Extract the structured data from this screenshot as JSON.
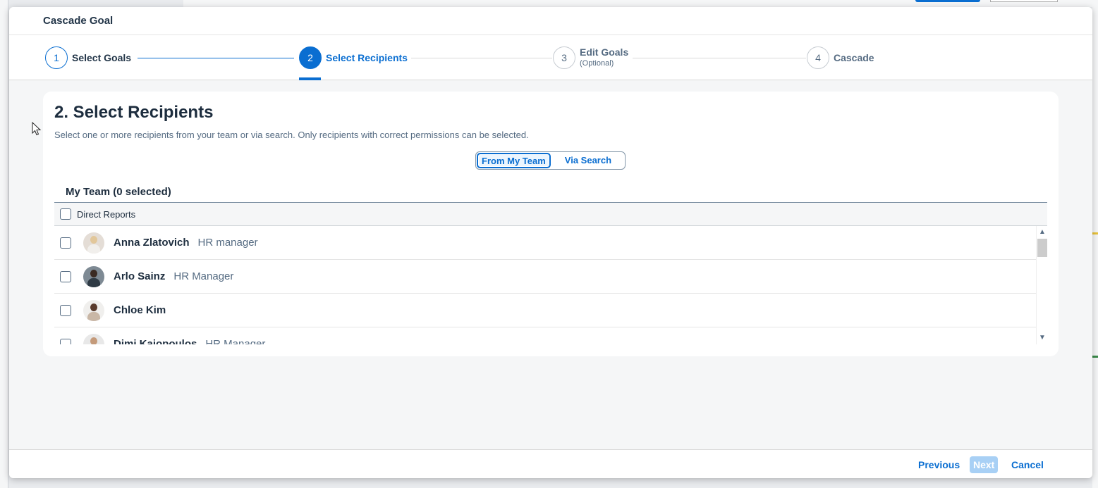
{
  "dialog": {
    "title": "Cascade Goal"
  },
  "wizard": {
    "steps": [
      {
        "number": "1",
        "label": "Select Goals",
        "sublabel": "",
        "state": "done"
      },
      {
        "number": "2",
        "label": "Select Recipients",
        "sublabel": "",
        "state": "active"
      },
      {
        "number": "3",
        "label": "Edit Goals",
        "sublabel": "(Optional)",
        "state": "pending"
      },
      {
        "number": "4",
        "label": "Cascade",
        "sublabel": "",
        "state": "pending"
      }
    ]
  },
  "content": {
    "heading": "2. Select Recipients",
    "description": "Select one or more recipients from your team or via search. Only recipients with correct permissions can be selected.",
    "segments": {
      "from_my_team": "From My Team",
      "via_search": "Via Search",
      "selected": "from_my_team"
    },
    "team_title": "My Team (0 selected)",
    "table_header": "Direct Reports",
    "rows": [
      {
        "name": "Anna Zlatovich",
        "role": "HR manager"
      },
      {
        "name": "Arlo Sainz",
        "role": "HR Manager"
      },
      {
        "name": "Chloe Kim",
        "role": ""
      },
      {
        "name": "Dimi Kaiopoulos",
        "role": "HR Manager"
      }
    ]
  },
  "footer": {
    "previous_label": "Previous",
    "next_label": "Next",
    "cancel_label": "Cancel"
  },
  "icons": {
    "scroll_up": "chevron-up-icon",
    "scroll_down": "chevron-down-icon",
    "cursor": "mouse-pointer-icon"
  },
  "colors": {
    "accent": "#0a6ed1",
    "next_disabled": "#a8d0f5",
    "text_primary": "#1d2d3e",
    "text_secondary": "#556b82"
  }
}
